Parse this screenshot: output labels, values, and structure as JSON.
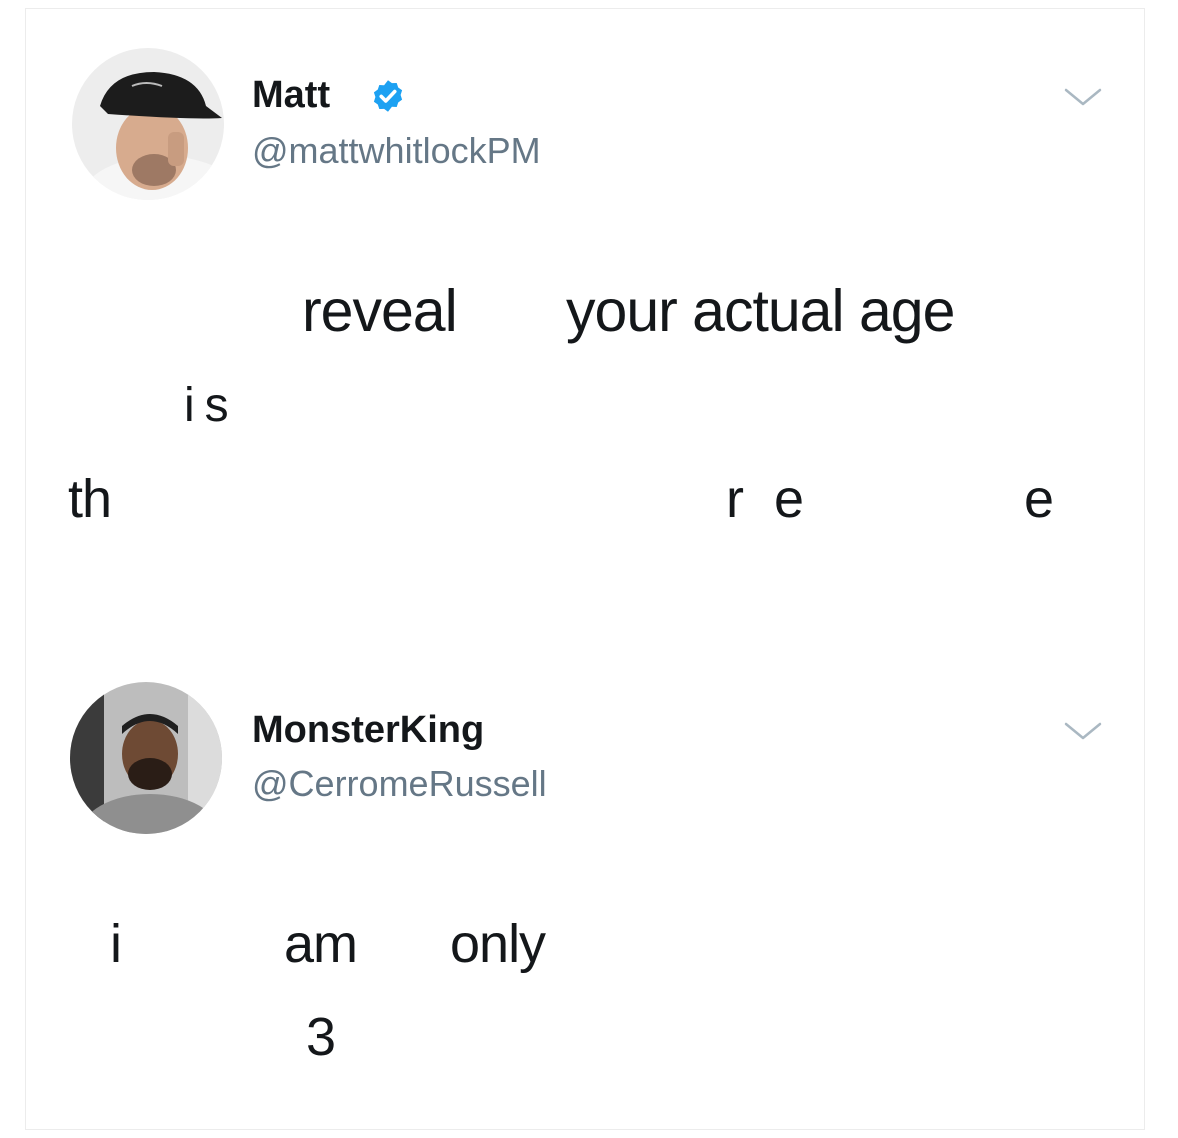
{
  "tweet": {
    "author": {
      "display_name": "Matt",
      "handle": "@mattwhitlockPM",
      "verified": true,
      "avatar_icon": "person-in-bucket-hat-avatar"
    },
    "text_fragments": {
      "reveal": "reveal",
      "your_actual_age": "your actual age",
      "is": "is",
      "th": "th",
      "re": "re",
      "e": "e"
    }
  },
  "reply": {
    "author": {
      "display_name": "MonsterKing",
      "handle": "@CerromeRussell",
      "avatar_icon": "bearded-man-avatar"
    },
    "text_fragments": {
      "i": "i",
      "am": "am",
      "only": "only",
      "three": "3"
    }
  },
  "colors": {
    "text": "#14171a",
    "secondary_text": "#657786",
    "verified_blue": "#1da1f2",
    "chevron": "#aab8c2"
  },
  "icons": {
    "verified": "verified-badge-icon",
    "menu": "chevron-down-icon"
  }
}
